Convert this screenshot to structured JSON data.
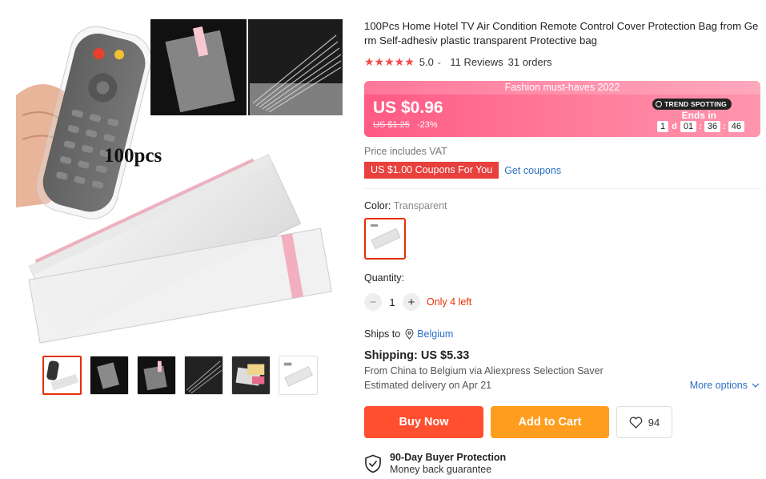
{
  "gallery": {
    "main_label": "100pcs",
    "thumbnail_count": 6,
    "active_thumbnail": 1
  },
  "product": {
    "title": "100Pcs Home Hotel TV Air Condition Remote Control Cover Protection Bag from Germ Self-adhesiv plastic transparent Protective bag",
    "stars": "★★★★★",
    "rating": "5.0",
    "reviews": "11 Reviews",
    "orders": "31 orders"
  },
  "promo": {
    "banner": "Fashion must-haves 2022",
    "price": "US $0.96",
    "old_price": "US $1.25",
    "discount": "-23%",
    "trend_badge": "TREND SPOTTING",
    "ends_label": "Ends in",
    "days": "1",
    "days_label": "d",
    "hours": "01",
    "minutes": "36",
    "seconds": "46",
    "accent": "#ff5a84"
  },
  "pricing": {
    "vat": "Price includes VAT",
    "coupon": "US $1.00 Coupons For You",
    "get_coupons": "Get coupons"
  },
  "color": {
    "label": "Color:",
    "value": "Transparent"
  },
  "quantity": {
    "label": "Quantity:",
    "value": "1",
    "minus": "−",
    "plus": "+",
    "stock": "Only 4 left"
  },
  "shipping": {
    "ships_to_label": "Ships to",
    "country": "Belgium",
    "cost": "Shipping: US $5.33",
    "route": "From China to Belgium via Aliexpress Selection Saver",
    "estimate": "Estimated delivery on Apr 21",
    "more_options": "More options"
  },
  "actions": {
    "buy_now": "Buy Now",
    "add_to_cart": "Add to Cart",
    "wishlist_count": "94",
    "buy_color": "#ff4f2e",
    "cart_color": "#ff9d1f"
  },
  "protection": {
    "title": "90-Day Buyer Protection",
    "subtitle": "Money back guarantee"
  }
}
